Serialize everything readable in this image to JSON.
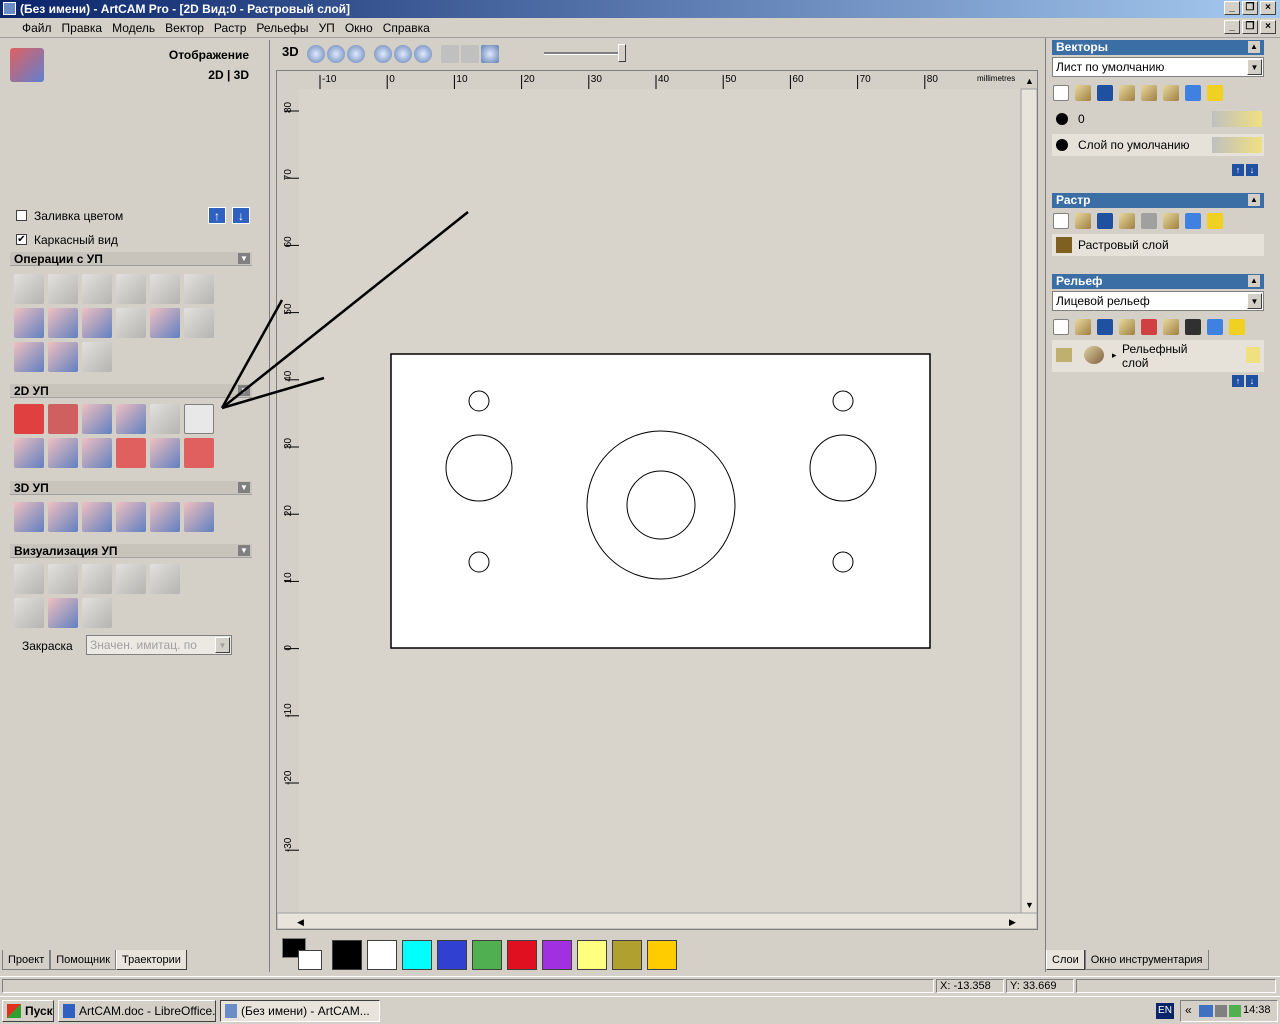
{
  "window": {
    "title": "(Без имени) - ArtCAM Pro - [2D Вид:0 - Растровый слой]"
  },
  "menu": [
    "Файл",
    "Правка",
    "Модель",
    "Вектор",
    "Растр",
    "Рельефы",
    "УП",
    "Окно",
    "Справка"
  ],
  "left": {
    "display_title": "Отображение",
    "display_mode": "2D | 3D",
    "fill_color_label": "Заливка цветом",
    "fill_color_checked": false,
    "wireframe_label": "Каркасный вид",
    "wireframe_checked": true,
    "sections": {
      "ops": "Операции с УП",
      "2d": "2D УП",
      "3d": "3D УП",
      "vis": "Визуализация УП"
    },
    "shading_label": "Закраска",
    "shading_value": "Значен. имитац. по",
    "tabs": [
      "Проект",
      "Помощник",
      "Траектории"
    ],
    "active_tab": "Траектории"
  },
  "viewport": {
    "mode_label": "3D",
    "units": "millimetres",
    "x_ticks": [
      "-10",
      "0",
      "10",
      "20",
      "30",
      "40",
      "50",
      "60",
      "70",
      "80"
    ],
    "y_ticks": [
      "80",
      "70",
      "60",
      "50",
      "40",
      "30",
      "20",
      "10",
      "0",
      "-10",
      "-20",
      "-30"
    ]
  },
  "palette": [
    "#000000",
    "#ffffff",
    "#00ffff",
    "#3040d0",
    "#50b050",
    "#e01020",
    "#a030e0",
    "#ffff80",
    "#b0a030",
    "#ffcc00"
  ],
  "right": {
    "vectors": {
      "title": "Векторы",
      "sheet": "Лист по умолчанию",
      "layers": [
        "0",
        "Слой по умолчанию"
      ]
    },
    "raster": {
      "title": "Растр",
      "layer": "Растровый слой"
    },
    "relief": {
      "title": "Рельеф",
      "value": "Лицевой рельеф",
      "layer_line1": "Рельефный",
      "layer_line2": "слой"
    },
    "tabs": [
      "Слои",
      "Окно инструментария"
    ]
  },
  "status": {
    "x": "X: -13.358",
    "y": "Y: 33.669"
  },
  "taskbar": {
    "start": "Пуск",
    "items": [
      "ArtCAM.doc - LibreOffice...",
      "(Без имени) - ArtCAM..."
    ],
    "lang": "EN",
    "time": "14:38"
  }
}
